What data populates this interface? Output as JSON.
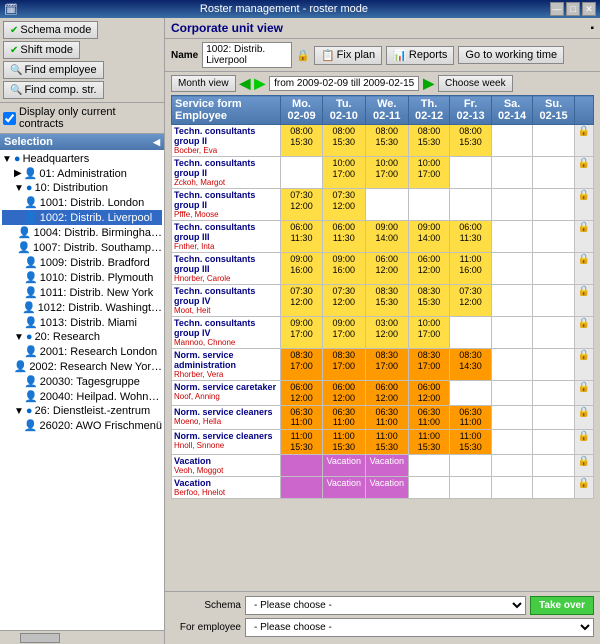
{
  "titleBar": {
    "text": "Roster management - roster mode",
    "btnMin": "—",
    "btnMax": "□",
    "btnClose": "✕"
  },
  "toolbar": {
    "schemaModeLabel": "Schema mode",
    "shiftModeLabel": "Shift mode",
    "findEmployeeLabel": "Find employee",
    "findCompStrLabel": "Find comp. str.",
    "displayOnlyCurrentLabel": "Display only current contracts"
  },
  "selection": {
    "title": "Selection"
  },
  "tree": [
    {
      "id": "hq",
      "label": "Headquarters",
      "indent": 0,
      "icon": "🔵",
      "type": "folder"
    },
    {
      "id": "01",
      "label": "01: Administration",
      "indent": 1,
      "icon": "👤",
      "type": "item"
    },
    {
      "id": "10",
      "label": "10: Distribution",
      "indent": 1,
      "icon": "📁",
      "type": "folder",
      "active": true
    },
    {
      "id": "1001",
      "label": "1001: Distrib. London",
      "indent": 2,
      "icon": "👤",
      "type": "item"
    },
    {
      "id": "1002",
      "label": "1002: Distrib. Liverpool",
      "indent": 2,
      "icon": "👤",
      "type": "item",
      "selected": true
    },
    {
      "id": "1004",
      "label": "1004: Distrib. Birmingha…",
      "indent": 2,
      "icon": "👤",
      "type": "item"
    },
    {
      "id": "1007",
      "label": "1007: Distrib. Southamp…",
      "indent": 2,
      "icon": "👤",
      "type": "item"
    },
    {
      "id": "1009",
      "label": "1009: Distrib. Bradford",
      "indent": 2,
      "icon": "👤",
      "type": "item"
    },
    {
      "id": "1010",
      "label": "1010: Distrib. Plymouth",
      "indent": 2,
      "icon": "👤",
      "type": "item"
    },
    {
      "id": "1011",
      "label": "1011: Distrib. New York",
      "indent": 2,
      "icon": "👤",
      "type": "item"
    },
    {
      "id": "1012",
      "label": "1012: Distrib. Washingt…",
      "indent": 2,
      "icon": "👤",
      "type": "item"
    },
    {
      "id": "1013",
      "label": "1013: Distrib. Miami",
      "indent": 2,
      "icon": "👤",
      "type": "item"
    },
    {
      "id": "20",
      "label": "20: Research",
      "indent": 1,
      "icon": "📁",
      "type": "folder"
    },
    {
      "id": "2001",
      "label": "2001: Research London",
      "indent": 2,
      "icon": "👤",
      "type": "item"
    },
    {
      "id": "2002",
      "label": "2002: Research New Yor…",
      "indent": 2,
      "icon": "👤",
      "type": "item"
    },
    {
      "id": "20030",
      "label": "20030: Tagesgruppe",
      "indent": 2,
      "icon": "👤",
      "type": "item"
    },
    {
      "id": "20040",
      "label": "20040: Heilpad. Wohn…",
      "indent": 2,
      "icon": "👤",
      "type": "item"
    },
    {
      "id": "26",
      "label": "26: Dienstleist.-zentrum",
      "indent": 1,
      "icon": "📁",
      "type": "folder"
    },
    {
      "id": "26020",
      "label": "26020: AWO Frischmenü",
      "indent": 2,
      "icon": "👤",
      "type": "item"
    }
  ],
  "corpView": {
    "title": "Corporate unit view",
    "nameLabel": "Name",
    "nameValue": "1002: Distrib.\nLiverpool",
    "fixPlanLabel": "Fix plan",
    "reportsLabel": "Reports",
    "goToWorkingTimeLabel": "Go to working time",
    "monthViewLabel": "Month view",
    "dateRange": "from 2009-02-09 till 2009-02-15",
    "chooseWeekLabel": "Choose week"
  },
  "tableHeaders": {
    "serviceForm": "Service form",
    "employee": "Employee",
    "mo": {
      "day": "Mo.",
      "date": "02-09"
    },
    "tu": {
      "day": "Tu.",
      "date": "02-10"
    },
    "we": {
      "day": "We.",
      "date": "02-11"
    },
    "th": {
      "day": "Th.",
      "date": "02-12"
    },
    "fr": {
      "day": "Fr.",
      "date": "02-13"
    },
    "sa": {
      "day": "Sa.",
      "date": "02-14"
    },
    "su": {
      "day": "Su.",
      "date": "02-15"
    }
  },
  "rows": [
    {
      "service": "Techn. consultants group II",
      "employee": "Bocber, Eva",
      "mo": {
        "time": "08:00\n15:30",
        "color": "yellow"
      },
      "tu": {
        "time": "08:00\n15:30",
        "color": "yellow"
      },
      "we": {
        "time": "08:00\n15:30",
        "color": "yellow"
      },
      "th": {
        "time": "08:00\n15:30",
        "color": "yellow"
      },
      "fr": {
        "time": "08:00\n15:30",
        "color": "yellow"
      },
      "sa": {
        "time": "",
        "color": "empty"
      },
      "su": {
        "time": "",
        "color": "empty"
      }
    },
    {
      "service": "Techn. consultants group II",
      "employee": "Zckoh, Margot",
      "mo": {
        "time": "",
        "color": "empty"
      },
      "tu": {
        "time": "10:00\n17:00",
        "color": "yellow"
      },
      "we": {
        "time": "10:00\n17:00",
        "color": "yellow"
      },
      "th": {
        "time": "10:00\n17:00",
        "color": "yellow"
      },
      "fr": {
        "time": "",
        "color": "empty"
      },
      "sa": {
        "time": "",
        "color": "empty"
      },
      "su": {
        "time": "",
        "color": "empty"
      }
    },
    {
      "service": "Techn. consultants group II",
      "employee": "Pfffe, Moose",
      "mo": {
        "time": "07:30\n12:00",
        "color": "yellow"
      },
      "tu": {
        "time": "07:30\n12:00",
        "color": "yellow"
      },
      "we": {
        "time": "",
        "color": "empty"
      },
      "th": {
        "time": "",
        "color": "empty"
      },
      "fr": {
        "time": "",
        "color": "empty"
      },
      "sa": {
        "time": "",
        "color": "empty"
      },
      "su": {
        "time": "",
        "color": "empty"
      }
    },
    {
      "service": "Techn. consultants group III",
      "employee": "Fnther, Inta",
      "mo": {
        "time": "06:00\n11:30",
        "color": "yellow"
      },
      "tu": {
        "time": "06:00\n11:30",
        "color": "yellow"
      },
      "we": {
        "time": "09:00\n14:00",
        "color": "yellow"
      },
      "th": {
        "time": "09:00\n14:00",
        "color": "yellow"
      },
      "fr": {
        "time": "06:00\n11:30",
        "color": "yellow"
      },
      "sa": {
        "time": "",
        "color": "empty"
      },
      "su": {
        "time": "",
        "color": "empty"
      }
    },
    {
      "service": "Techn. consultants group III",
      "employee": "Hnorber, Carole",
      "mo": {
        "time": "09:00\n16:00",
        "color": "yellow"
      },
      "tu": {
        "time": "09:00\n16:00",
        "color": "yellow"
      },
      "we": {
        "time": "06:00\n12:00",
        "color": "yellow"
      },
      "th": {
        "time": "06:00\n12:00",
        "color": "yellow"
      },
      "fr": {
        "time": "11:00\n16:00",
        "color": "yellow"
      },
      "sa": {
        "time": "",
        "color": "empty"
      },
      "su": {
        "time": "",
        "color": "empty"
      }
    },
    {
      "service": "Techn. consultants group IV",
      "employee": "Moot, Heit",
      "mo": {
        "time": "07:30\n12:00",
        "color": "yellow"
      },
      "tu": {
        "time": "07:30\n12:00",
        "color": "yellow"
      },
      "we": {
        "time": "08:30\n15:30",
        "color": "yellow"
      },
      "th": {
        "time": "08:30\n15:30",
        "color": "yellow"
      },
      "fr": {
        "time": "07:30\n12:00",
        "color": "yellow"
      },
      "sa": {
        "time": "",
        "color": "empty"
      },
      "su": {
        "time": "",
        "color": "empty"
      }
    },
    {
      "service": "Techn. consultants group IV",
      "employee": "Mannoo, Chnone",
      "mo": {
        "time": "09:00\n17:00",
        "color": "yellow"
      },
      "tu": {
        "time": "09:00\n17:00",
        "color": "yellow"
      },
      "we": {
        "time": "03:00\n12:00",
        "color": "yellow"
      },
      "th": {
        "time": "10:00\n17:00",
        "color": "yellow"
      },
      "fr": {
        "time": "",
        "color": "empty"
      },
      "sa": {
        "time": "",
        "color": "empty"
      },
      "su": {
        "time": "",
        "color": "empty"
      }
    },
    {
      "service": "Norm. service administration",
      "employee": "Rhorber, Vera",
      "mo": {
        "time": "08:30\n17:00",
        "color": "orange"
      },
      "tu": {
        "time": "08:30\n17:00",
        "color": "orange"
      },
      "we": {
        "time": "08:30\n17:00",
        "color": "orange"
      },
      "th": {
        "time": "08:30\n17:00",
        "color": "orange"
      },
      "fr": {
        "time": "08:30\n14:30",
        "color": "orange"
      },
      "sa": {
        "time": "",
        "color": "empty"
      },
      "su": {
        "time": "",
        "color": "empty"
      }
    },
    {
      "service": "Norm. service caretaker",
      "employee": "Noof, Anning",
      "mo": {
        "time": "06:00\n12:00",
        "color": "orange"
      },
      "tu": {
        "time": "06:00\n12:00",
        "color": "orange"
      },
      "we": {
        "time": "06:00\n12:00",
        "color": "orange"
      },
      "th": {
        "time": "06:00\n12:00",
        "color": "orange"
      },
      "fr": {
        "time": "",
        "color": "empty"
      },
      "sa": {
        "time": "",
        "color": "empty"
      },
      "su": {
        "time": "",
        "color": "empty"
      }
    },
    {
      "service": "Norm. service cleaners",
      "employee": "Moeno, Hella",
      "mo": {
        "time": "06:30\n11:00",
        "color": "orange"
      },
      "tu": {
        "time": "06:30\n11:00",
        "color": "orange"
      },
      "we": {
        "time": "06:30\n11:00",
        "color": "orange"
      },
      "th": {
        "time": "06:30\n11:00",
        "color": "orange"
      },
      "fr": {
        "time": "06:30\n11:00",
        "color": "orange"
      },
      "sa": {
        "time": "",
        "color": "empty"
      },
      "su": {
        "time": "",
        "color": "empty"
      }
    },
    {
      "service": "Norm. service cleaners",
      "employee": "Hnoll, Snnone",
      "mo": {
        "time": "11:00\n15:30",
        "color": "orange"
      },
      "tu": {
        "time": "11:00\n15:30",
        "color": "orange"
      },
      "we": {
        "time": "11:00\n15:30",
        "color": "orange"
      },
      "th": {
        "time": "11:00\n15:30",
        "color": "orange"
      },
      "fr": {
        "time": "11:00\n15:30",
        "color": "orange"
      },
      "sa": {
        "time": "",
        "color": "empty"
      },
      "su": {
        "time": "",
        "color": "empty"
      }
    },
    {
      "service": "Vacation",
      "employee": "Veoh, Moggot",
      "mo": {
        "time": "",
        "color": "purple"
      },
      "tu": {
        "time": "Vacation",
        "color": "purple"
      },
      "we": {
        "time": "Vacation",
        "color": "purple"
      },
      "th": {
        "time": "",
        "color": "empty"
      },
      "fr": {
        "time": "",
        "color": "empty"
      },
      "sa": {
        "time": "",
        "color": "empty"
      },
      "su": {
        "time": "",
        "color": "empty"
      }
    },
    {
      "service": "Vacation",
      "employee": "Berfoo, Hnelot",
      "mo": {
        "time": "",
        "color": "purple"
      },
      "tu": {
        "time": "Vacation",
        "color": "purple"
      },
      "we": {
        "time": "Vacation",
        "color": "purple"
      },
      "th": {
        "time": "",
        "color": "empty"
      },
      "fr": {
        "time": "",
        "color": "empty"
      },
      "sa": {
        "time": "",
        "color": "empty"
      },
      "su": {
        "time": "",
        "color": "empty"
      }
    }
  ],
  "bottomBar": {
    "schemaLabel": "Schema",
    "forEmployeeLabel": "For employee",
    "pleaseChoose": "- Please choose -",
    "takeOverLabel": "Take over"
  }
}
